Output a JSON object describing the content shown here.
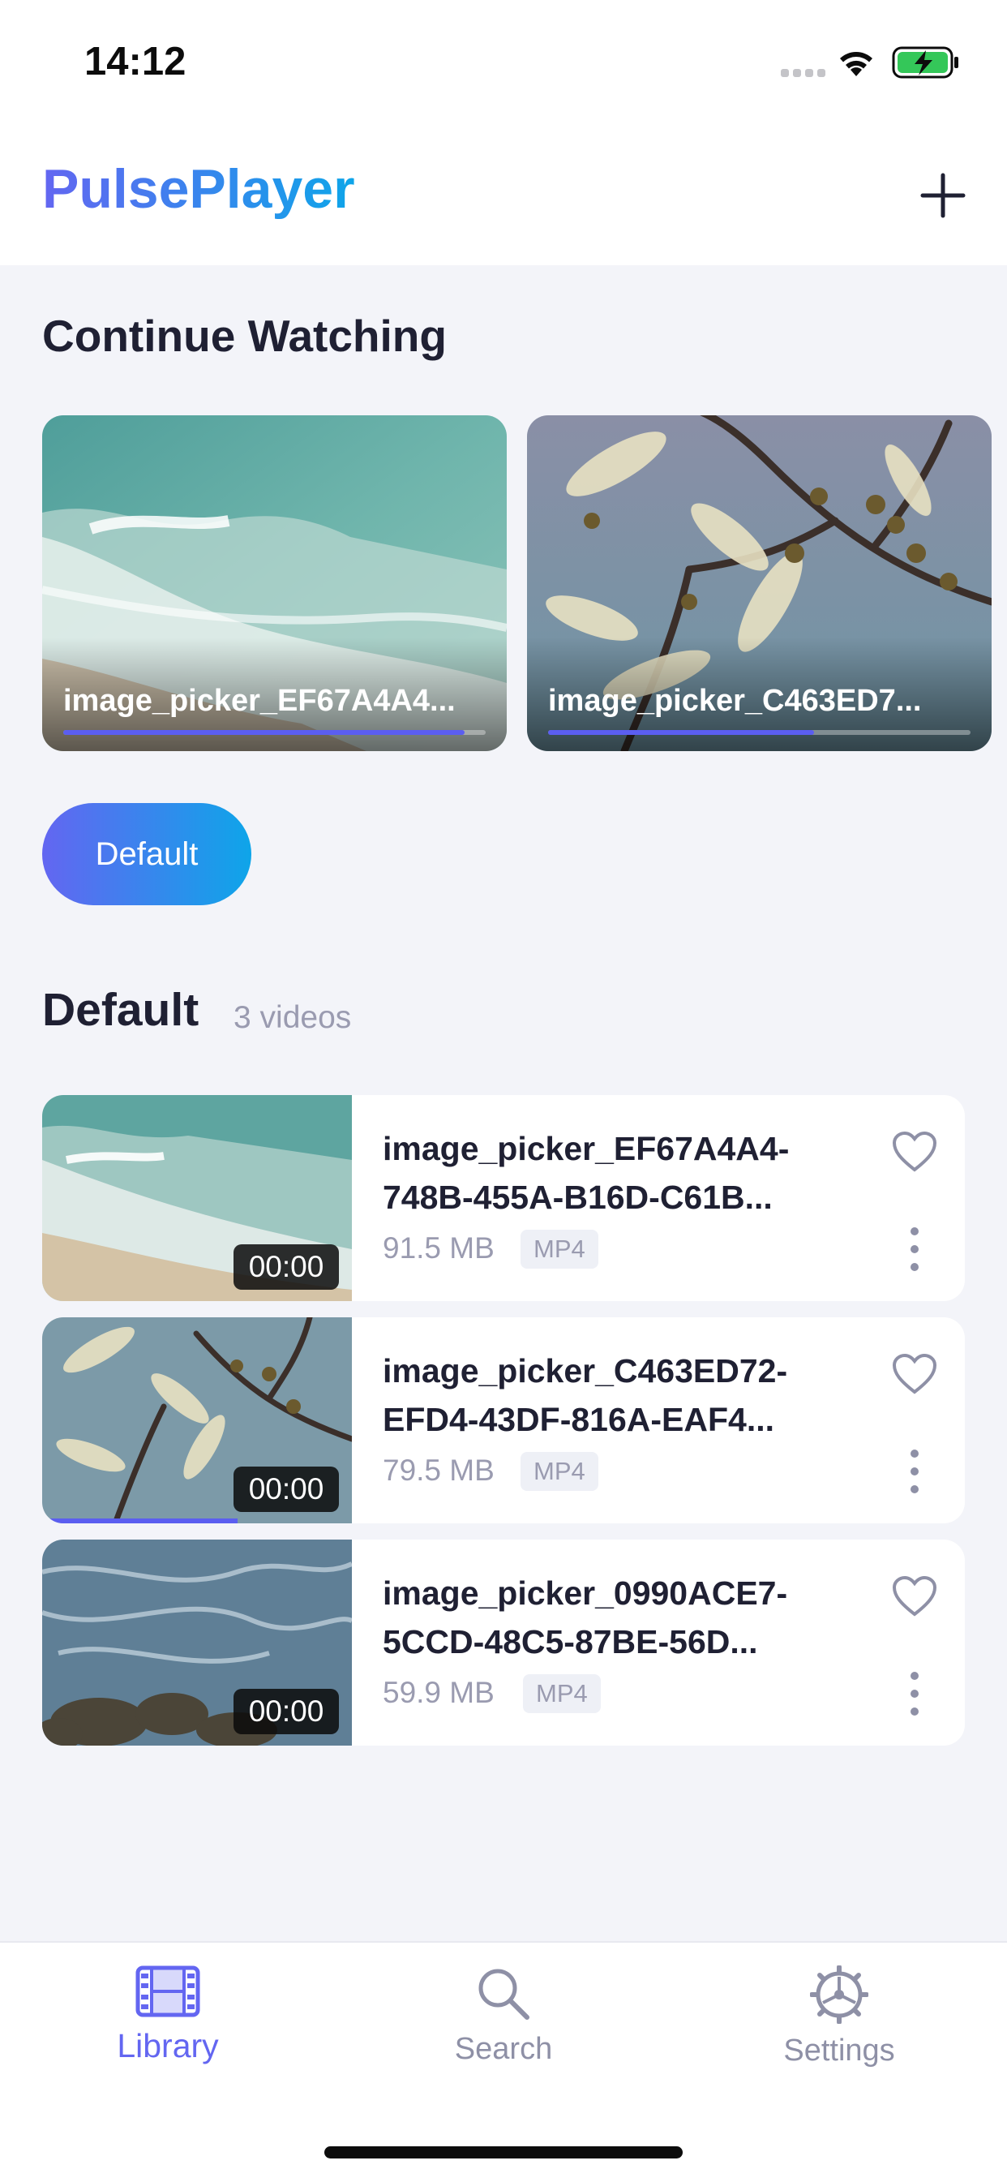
{
  "status_bar": {
    "time": "14:12"
  },
  "header": {
    "app_title": "PulsePlayer"
  },
  "continue_watching": {
    "title": "Continue Watching",
    "items": [
      {
        "title": "image_picker_EF67A4A4...",
        "progress": 0.95,
        "thumbnail": "ocean-waves"
      },
      {
        "title": "image_picker_C463ED7...",
        "progress": 0.63,
        "thumbnail": "acacia-branches"
      }
    ]
  },
  "folder_chip": {
    "label": "Default"
  },
  "group": {
    "title": "Default",
    "count": "3 videos",
    "videos": [
      {
        "name_line1": "image_picker_EF67A4A4-",
        "name_line2": "748B-455A-B16D-C61B...",
        "size": "91.5 MB",
        "format": "MP4",
        "duration": "00:00",
        "thumbnail": "ocean-waves",
        "progress": 0
      },
      {
        "name_line1": "image_picker_C463ED72-",
        "name_line2": "EFD4-43DF-816A-EAF4...",
        "size": "79.5 MB",
        "format": "MP4",
        "duration": "00:00",
        "thumbnail": "acacia-branches",
        "progress": 0.63
      },
      {
        "name_line1": "image_picker_0990ACE7-",
        "name_line2": "5CCD-48C5-87BE-56D...",
        "size": "59.9 MB",
        "format": "MP4",
        "duration": "00:00",
        "thumbnail": "rocky-shore",
        "progress": 0
      }
    ]
  },
  "tabs": [
    {
      "label": "Library",
      "icon": "film-icon",
      "active": true
    },
    {
      "label": "Search",
      "icon": "search-icon",
      "active": false
    },
    {
      "label": "Settings",
      "icon": "gear-icon",
      "active": false
    }
  ],
  "colors": {
    "accent": "#6366f1",
    "accent_end": "#0ea5e9",
    "background": "#f3f4f9",
    "muted": "#9a9bb0"
  }
}
